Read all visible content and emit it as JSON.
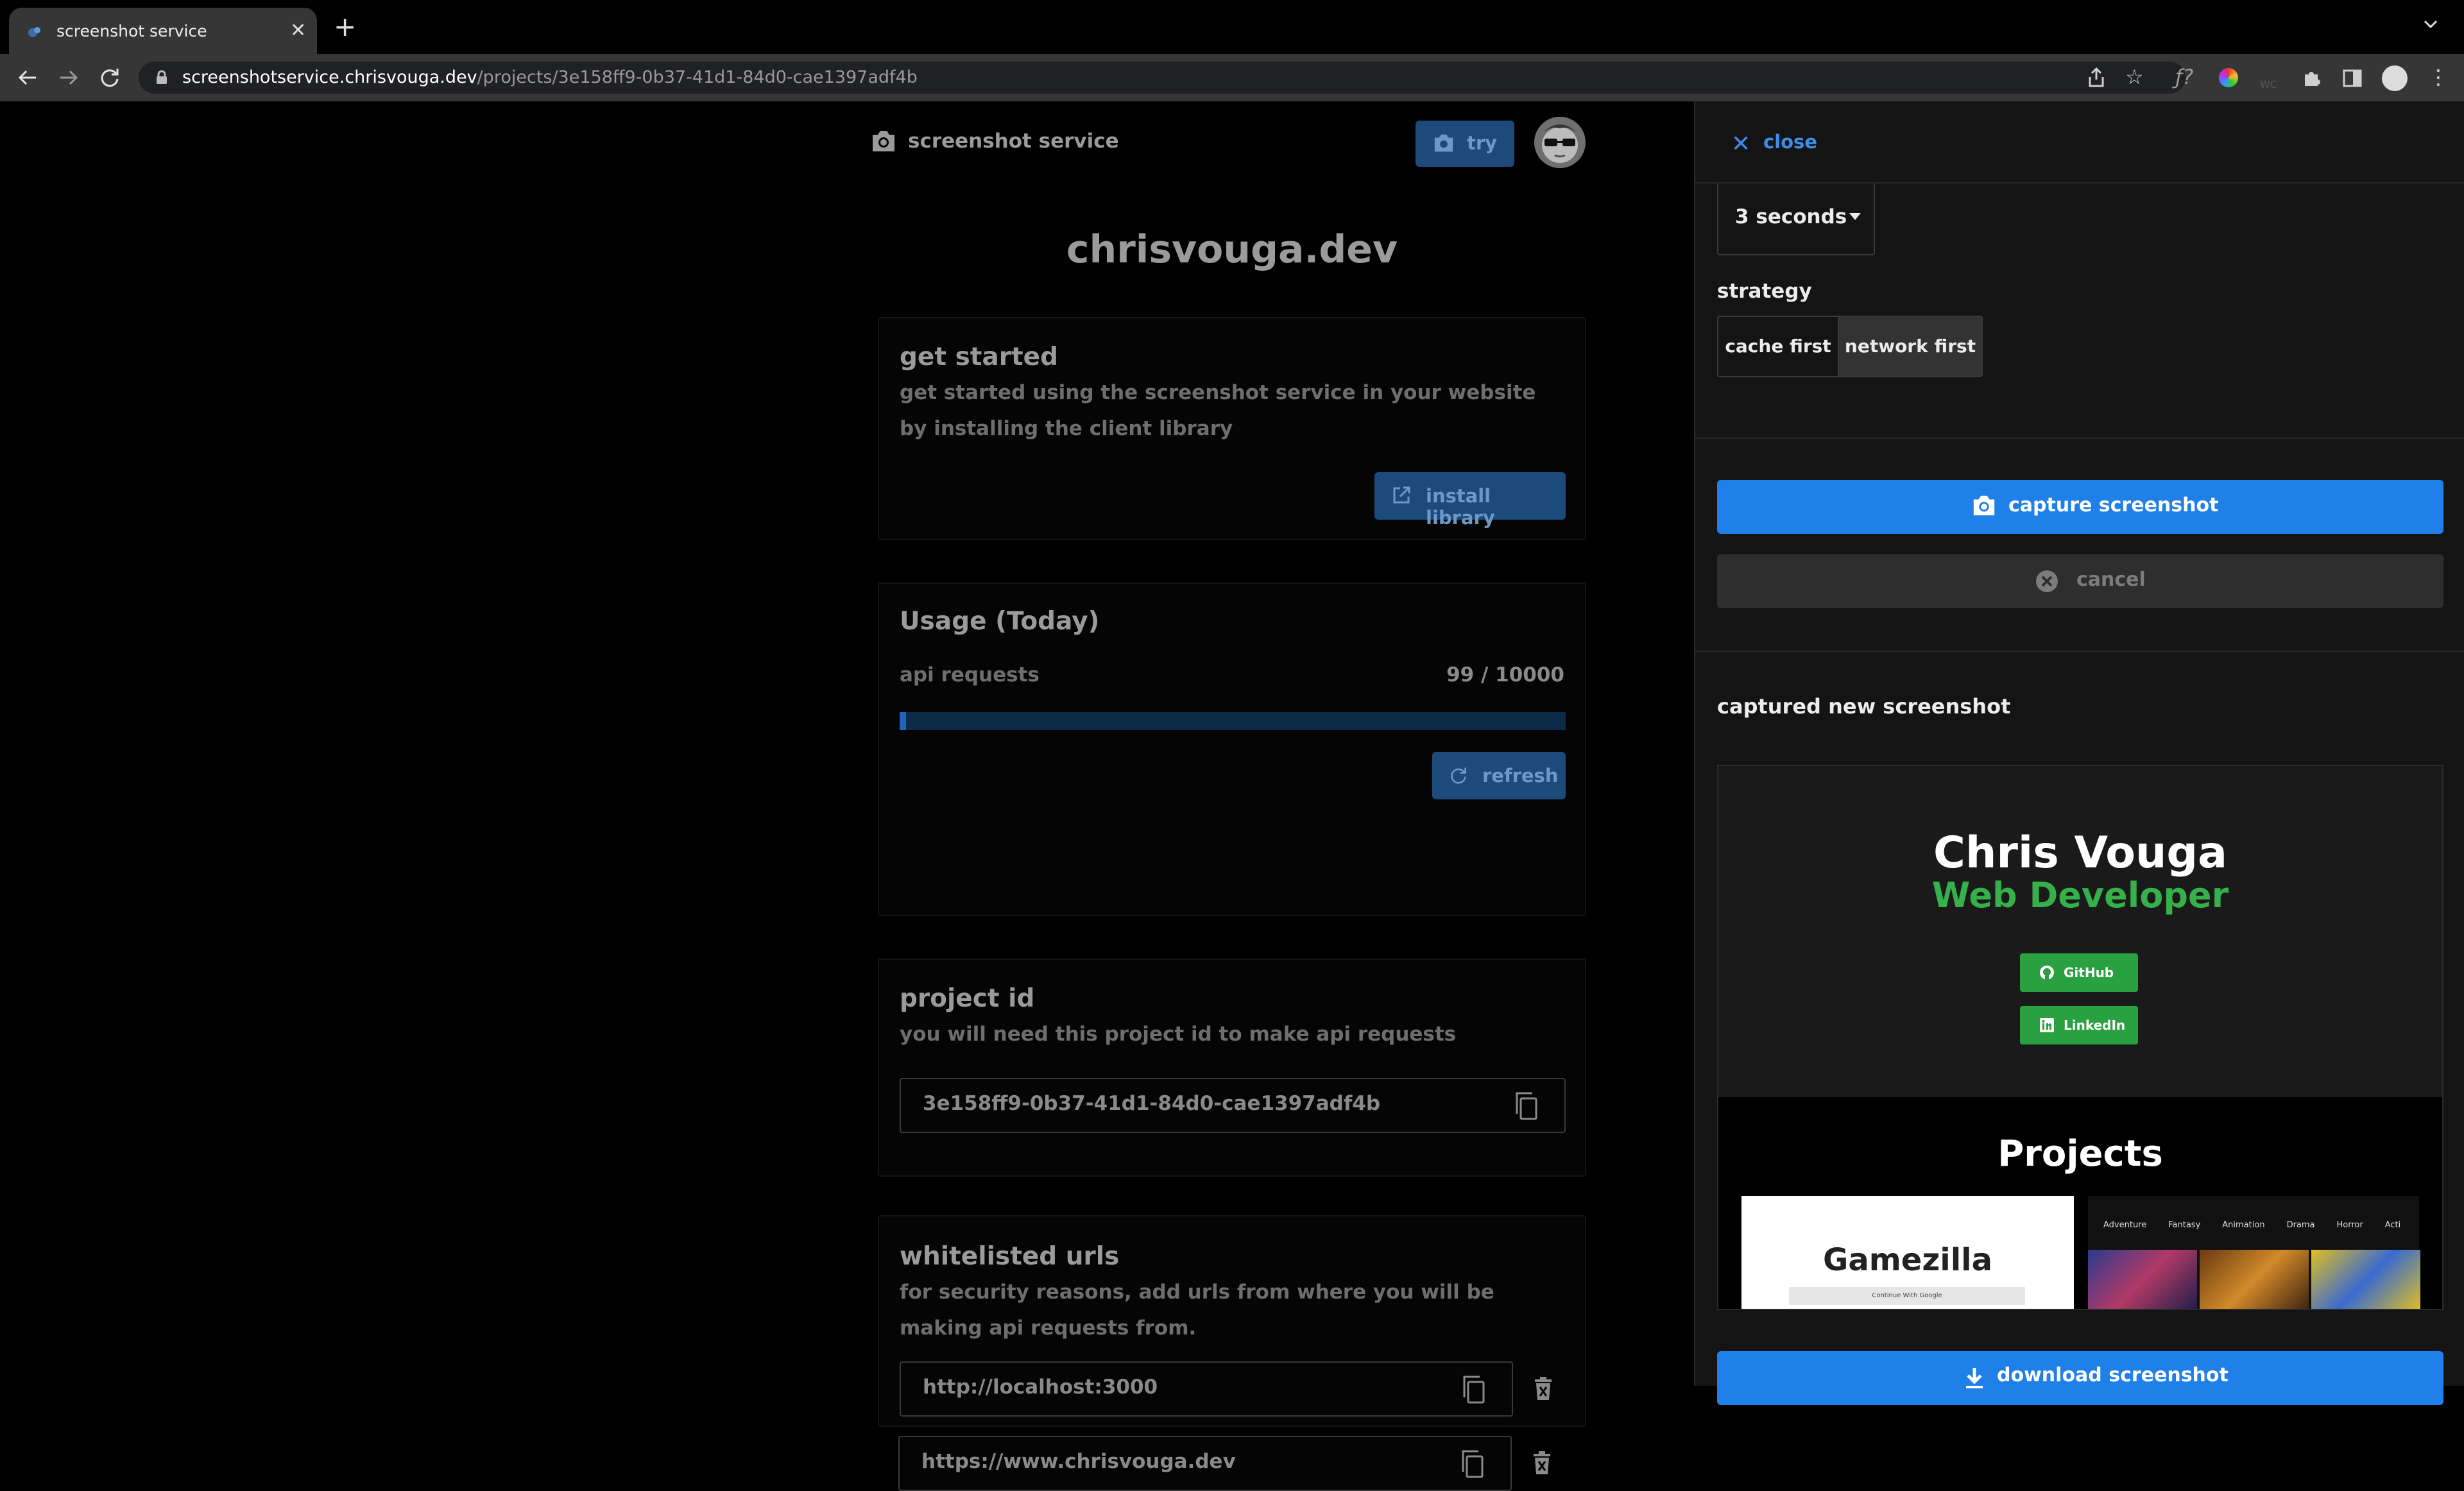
{
  "browser": {
    "tab_title": "screenshot service",
    "url_host": "screenshotservice.chrisvouga.dev",
    "url_path": "/projects/3e158ff9-0b37-41d1-84d0-cae1397adf4b"
  },
  "header": {
    "brand": "screenshot service",
    "try_label": "try"
  },
  "project": {
    "title": "chrisvouga.dev"
  },
  "get_started": {
    "title": "get started",
    "text": "get started using the screenshot service in your website by installing the client library",
    "button": "install library"
  },
  "usage": {
    "title": "Usage (Today)",
    "label": "api requests",
    "count": "99 / 10000",
    "progress_fraction": 0.0099,
    "button": "refresh"
  },
  "project_id": {
    "title": "project id",
    "text": "you will need this project id to make api requests",
    "value": "3e158ff9-0b37-41d1-84d0-cae1397adf4b"
  },
  "whitelist": {
    "title": "whitelisted urls",
    "text": "for security reasons, add urls from where you will be making api requests from.",
    "urls": [
      "http://localhost:3000",
      "https://www.chrisvouga.dev"
    ]
  },
  "panel": {
    "close_label": "close",
    "delay_value": "3 seconds",
    "strategy_label": "strategy",
    "strategy_options": [
      "cache first",
      "network first"
    ],
    "strategy_selected": "network first",
    "capture_label": "capture screenshot",
    "cancel_label": "cancel",
    "captured_title": "captured new screenshot",
    "download_label": "download screenshot"
  },
  "preview": {
    "name": "Chris Vouga",
    "role": "Web Developer",
    "github": "GitHub",
    "linkedin": "LinkedIn",
    "projects_heading": "Projects",
    "project1_title": "Gamezilla",
    "project1_button": "Continue With Google",
    "movie_categories": [
      "Adventure",
      "Fantasy",
      "Animation",
      "Drama",
      "Horror",
      "Acti"
    ]
  },
  "colors": {
    "accent": "#1f80e9",
    "link": "#3d8ee8",
    "preview_green": "#36b04a"
  }
}
